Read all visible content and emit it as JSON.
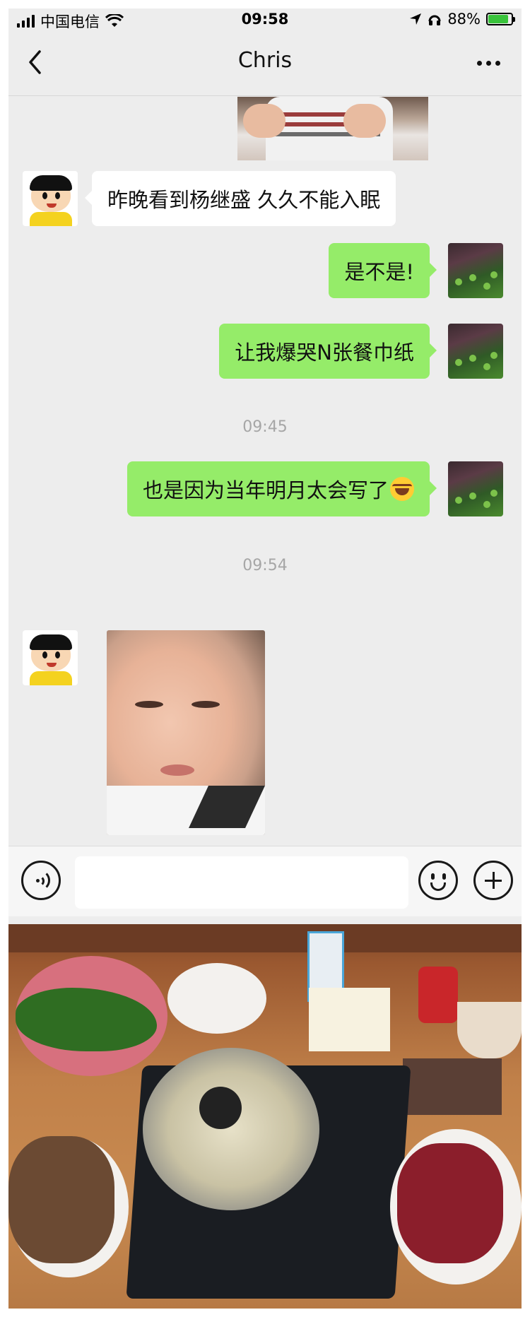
{
  "status_bar": {
    "carrier": "中国电信",
    "time": "09:58",
    "battery_percent": "88%",
    "battery_level": 0.88
  },
  "nav": {
    "title": "Chris"
  },
  "messages": [
    {
      "side": "in",
      "text": "昨晚看到杨继盛 久久不能入眠"
    },
    {
      "side": "out",
      "text": "是不是!"
    },
    {
      "side": "out",
      "text": "让我爆哭N张餐巾纸"
    },
    {
      "side": "out",
      "text": "也是因为当年明月太会写了"
    }
  ],
  "timestamps": [
    "09:45",
    "09:54"
  ],
  "input": {
    "value": ""
  },
  "icons": [
    "back-icon",
    "more-icon",
    "wifi-icon",
    "location-icon",
    "headphones-icon",
    "battery-icon",
    "voice-icon",
    "emoji-icon",
    "plus-icon"
  ],
  "colors": {
    "chat_bg": "#ededed",
    "outgoing_bubble": "#95ec69",
    "incoming_bubble": "#ffffff",
    "timestamp": "#a6a6a6"
  }
}
